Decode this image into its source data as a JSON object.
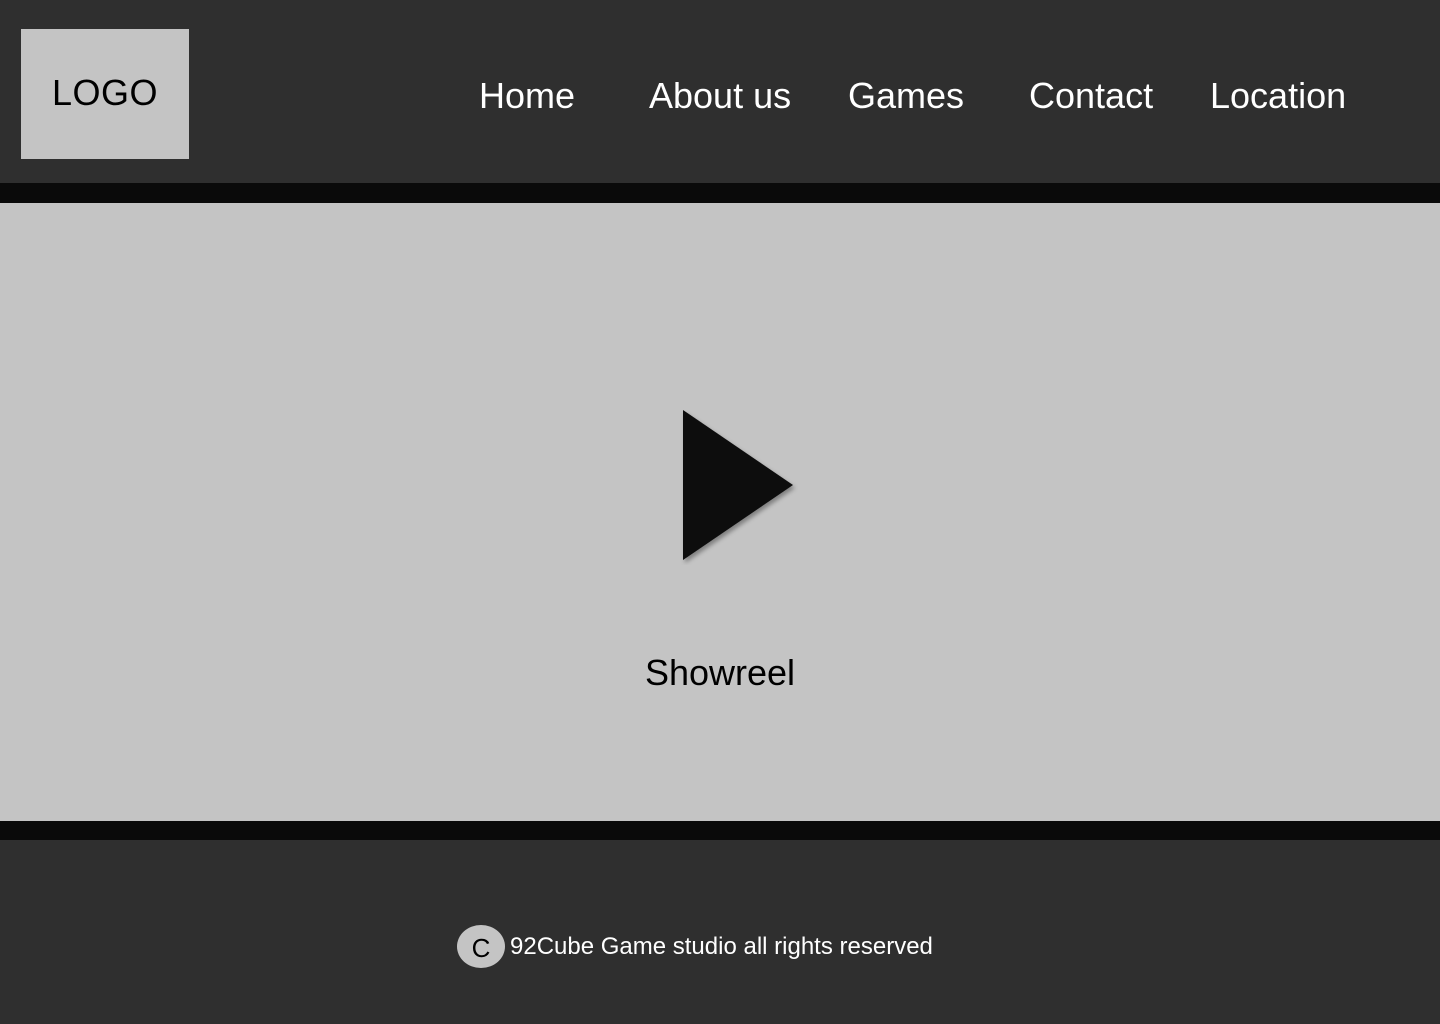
{
  "header": {
    "logo_text": "LOGO",
    "nav": {
      "home": "Home",
      "about": "About us",
      "games": "Games",
      "contact": "Contact",
      "location": "Location"
    }
  },
  "hero": {
    "play_icon": "play-icon",
    "caption": "Showreel"
  },
  "footer": {
    "copyright_symbol": "C",
    "copyright_text": "92Cube Game studio all rights reserved"
  },
  "colors": {
    "dark_background": "#2f2f2f",
    "divider_bar": "#0a0a0a",
    "light_panel": "#c4c4c4",
    "nav_text": "#ffffff"
  }
}
